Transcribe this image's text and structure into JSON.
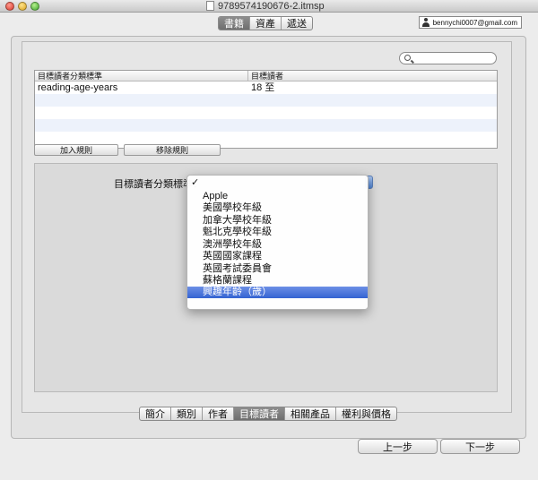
{
  "window": {
    "title": "9789574190676-2.itmsp"
  },
  "user": {
    "email": "bennychi0007@gmail.com"
  },
  "top_tabs": [
    {
      "label": "書籍",
      "active": true
    },
    {
      "label": "資產",
      "active": false
    },
    {
      "label": "遞送",
      "active": false
    }
  ],
  "table": {
    "headers": [
      "目標讀者分類標準",
      "目標讀者"
    ],
    "rows": [
      [
        "reading-age-years",
        "18 至"
      ],
      [
        "",
        ""
      ],
      [
        "",
        ""
      ],
      [
        "",
        ""
      ]
    ]
  },
  "buttons": {
    "add_rule": "加入規則",
    "remove_rule": "移除規則"
  },
  "criteria": {
    "label": "目標讀者分類標準："
  },
  "dropdown": {
    "check_glyph": "✓",
    "options": [
      "",
      "Apple",
      "美國學校年級",
      "加拿大學校年級",
      "魁北克學校年級",
      "澳洲學校年級",
      "英國國家課程",
      "英國考試委員會",
      "蘇格蘭課程",
      "興趣年齡（歲）"
    ],
    "checked_index": 0,
    "highlighted_index": 9
  },
  "bottom_tabs": [
    {
      "label": "簡介",
      "active": false
    },
    {
      "label": "類別",
      "active": false
    },
    {
      "label": "作者",
      "active": false
    },
    {
      "label": "目標讀者",
      "active": true
    },
    {
      "label": "相關產品",
      "active": false
    },
    {
      "label": "權利與價格",
      "active": false
    }
  ],
  "nav": {
    "prev": "上一步",
    "next": "下一步"
  },
  "colors": {
    "selection": "#3463d2",
    "active_tab": "#7a7a7a"
  }
}
